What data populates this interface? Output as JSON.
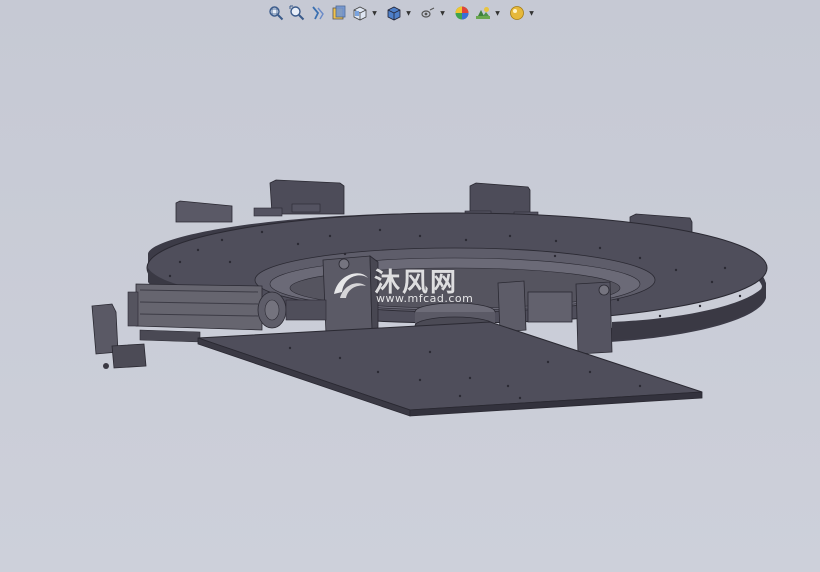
{
  "app": {
    "background_color": "#c9ccd6",
    "model_color": "#4a4955"
  },
  "heads_up_toolbar": {
    "items": [
      {
        "icon": "zoom-to-fit-icon",
        "has_dropdown": false
      },
      {
        "icon": "zoom-to-area-icon",
        "has_dropdown": false
      },
      {
        "icon": "previous-view-icon",
        "has_dropdown": false
      },
      {
        "icon": "section-view-icon",
        "has_dropdown": false
      },
      {
        "icon": "view-orientation-icon",
        "has_dropdown": true
      },
      {
        "icon": "display-style-icon",
        "has_dropdown": true
      },
      {
        "icon": "hide-show-items-icon",
        "has_dropdown": true
      },
      {
        "icon": "edit-appearance-icon",
        "has_dropdown": false
      },
      {
        "icon": "apply-scene-icon",
        "has_dropdown": true
      },
      {
        "icon": "view-settings-icon",
        "has_dropdown": true
      }
    ]
  },
  "watermark": {
    "text_cn": "沐风网",
    "url": "www.mfcad.com"
  }
}
